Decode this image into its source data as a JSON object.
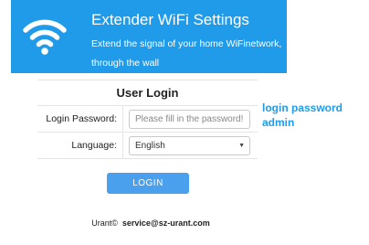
{
  "header": {
    "icon": "wifi-icon",
    "title": "Extender WiFi Settings",
    "subtitle": "Extend the signal of your home WiFinetwork, through the wall",
    "background_color": "#1f9bea"
  },
  "login_form": {
    "title": "User Login",
    "password_label": "Login Password:",
    "password_placeholder": "Please fill in the password!",
    "password_value": "",
    "language_label": "Language:",
    "language_selected": "English",
    "login_button_label": "LOGIN",
    "button_color": "#4aa0ec"
  },
  "hint": {
    "line1": "login password",
    "line2": "admin",
    "color": "#1f9bea"
  },
  "footer": {
    "brand": "Urant©",
    "email": "service@sz-urant.com"
  }
}
